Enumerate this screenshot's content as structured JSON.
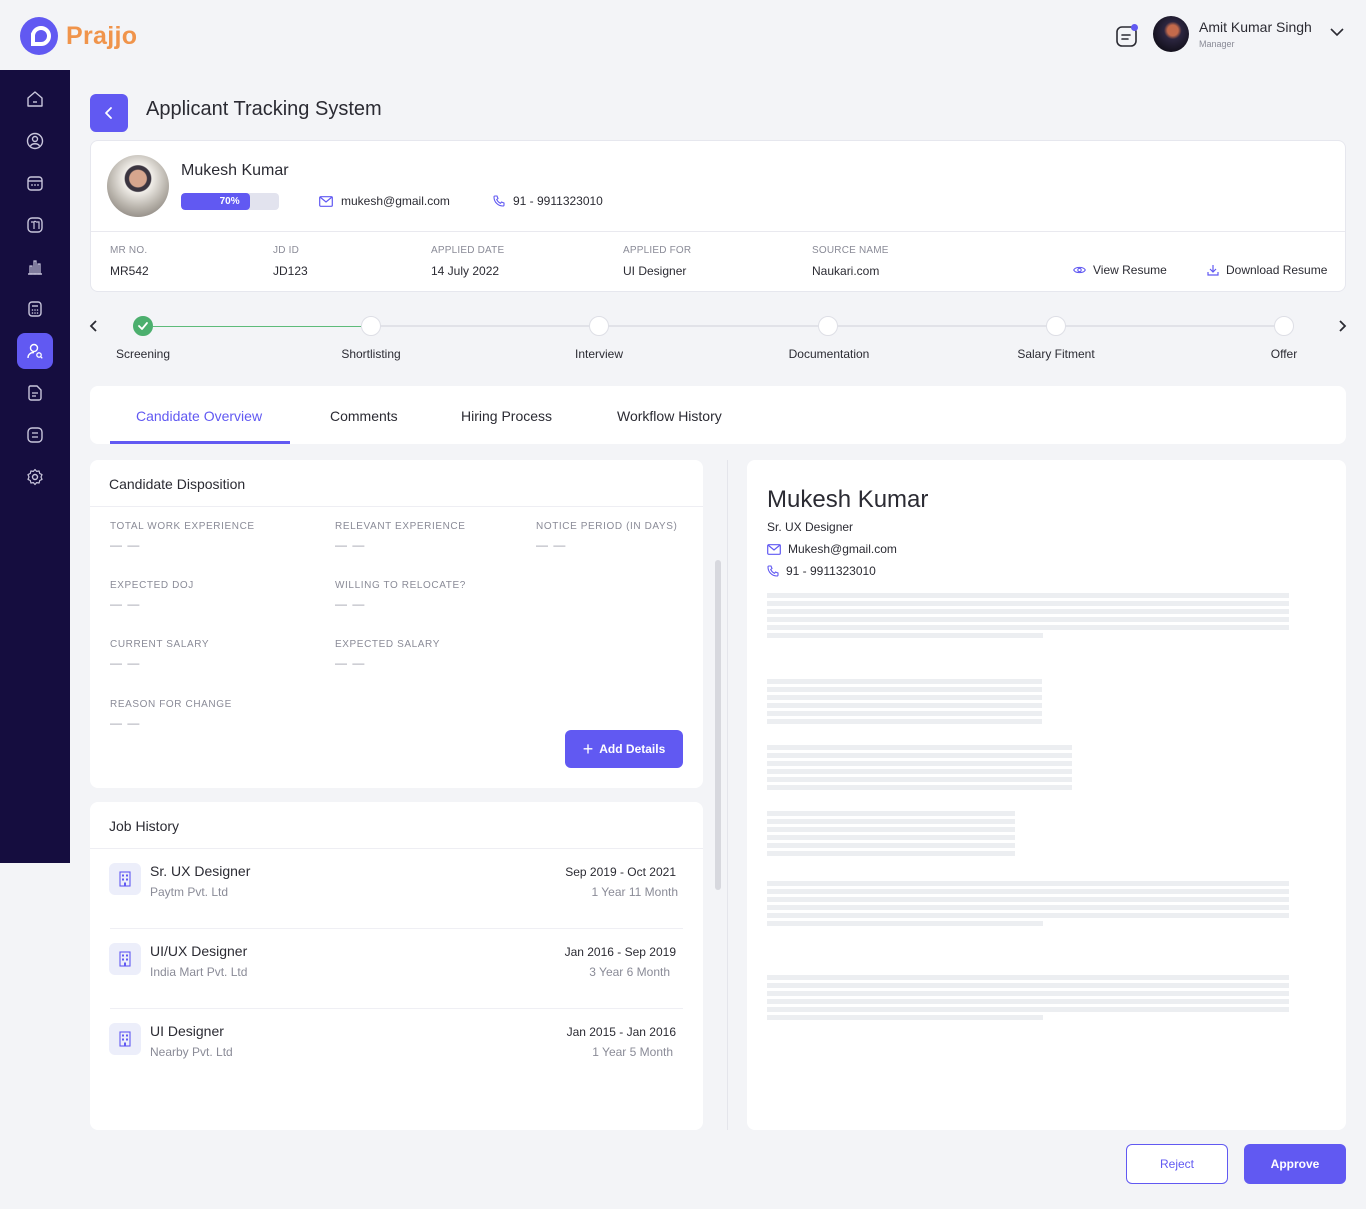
{
  "brand": {
    "name": "Prajjo",
    "accent": "#6159f2",
    "logo_color": "#f0944b",
    "sidebar_bg": "#150d3f"
  },
  "user": {
    "name": "Amit Kumar Singh",
    "role": "Manager"
  },
  "sidebar": {
    "items": [
      {
        "icon": "home-icon"
      },
      {
        "icon": "profile-icon"
      },
      {
        "icon": "calendar-icon"
      },
      {
        "icon": "book-icon"
      },
      {
        "icon": "bar-chart-icon"
      },
      {
        "icon": "calculator-icon"
      },
      {
        "icon": "user-search-icon",
        "active": true
      },
      {
        "icon": "document-icon"
      },
      {
        "icon": "list-icon"
      },
      {
        "icon": "settings-icon"
      }
    ]
  },
  "page": {
    "title": "Applicant Tracking System"
  },
  "candidate": {
    "name": "Mukesh Kumar",
    "progress_label": "70%",
    "progress_value": 0.7,
    "email": "mukesh@gmail.com",
    "phone": "91 - 9911323010",
    "meta": [
      {
        "label": "MR NO.",
        "value": "MR542"
      },
      {
        "label": "JD ID",
        "value": "JD123"
      },
      {
        "label": "APPLIED DATE",
        "value": "14 July 2022"
      },
      {
        "label": "APPLIED FOR",
        "value": "UI Designer"
      },
      {
        "label": "SOURCE NAME",
        "value": "Naukari.com"
      }
    ],
    "view_resume": "View Resume",
    "download_resume": "Download Resume"
  },
  "stepper": {
    "steps": [
      {
        "label": "Screening",
        "done": true
      },
      {
        "label": "Shortlisting",
        "done": false
      },
      {
        "label": "Interview",
        "done": false
      },
      {
        "label": "Documentation",
        "done": false
      },
      {
        "label": "Salary Fitment",
        "done": false
      },
      {
        "label": "Offer",
        "done": false
      }
    ]
  },
  "tabs": [
    {
      "label": "Candidate Overview",
      "active": true
    },
    {
      "label": "Comments"
    },
    {
      "label": "Hiring Process"
    },
    {
      "label": "Workflow History"
    }
  ],
  "disposition": {
    "title": "Candidate Disposition",
    "fields": [
      {
        "label": "TOTAL WORK EXPERIENCE",
        "value": "— —"
      },
      {
        "label": "RELEVANT EXPERIENCE",
        "value": "— —"
      },
      {
        "label": "NOTICE PERIOD (IN DAYS)",
        "value": "— —"
      },
      {
        "label": "EXPECTED DOJ",
        "value": "— —"
      },
      {
        "label": "WILLING TO RELOCATE?",
        "value": "— —"
      },
      {
        "label": "CURRENT SALARY",
        "value": "— —"
      },
      {
        "label": "EXPECTED SALARY",
        "value": "— —"
      },
      {
        "label": "REASON FOR CHANGE",
        "value": "— —"
      }
    ],
    "add_button": "Add Details"
  },
  "job_history": {
    "title": "Job History",
    "jobs": [
      {
        "title": "Sr. UX Designer",
        "company": "Paytm Pvt. Ltd",
        "dates": "Sep 2019 - Oct 2021",
        "duration": "1 Year 11 Month"
      },
      {
        "title": "UI/UX Designer",
        "company": "India Mart Pvt. Ltd",
        "dates": "Jan 2016 - Sep 2019",
        "duration": "3 Year 6 Month"
      },
      {
        "title": "UI Designer",
        "company": "Nearby Pvt. Ltd",
        "dates": "Jan 2015 - Jan 2016",
        "duration": "1 Year 5 Month"
      }
    ]
  },
  "resume": {
    "name": "Mukesh Kumar",
    "role": "Sr. UX Designer",
    "email": "Mukesh@gmail.com",
    "phone": "91 - 9911323010"
  },
  "actions": {
    "reject": "Reject",
    "approve": "Approve"
  }
}
